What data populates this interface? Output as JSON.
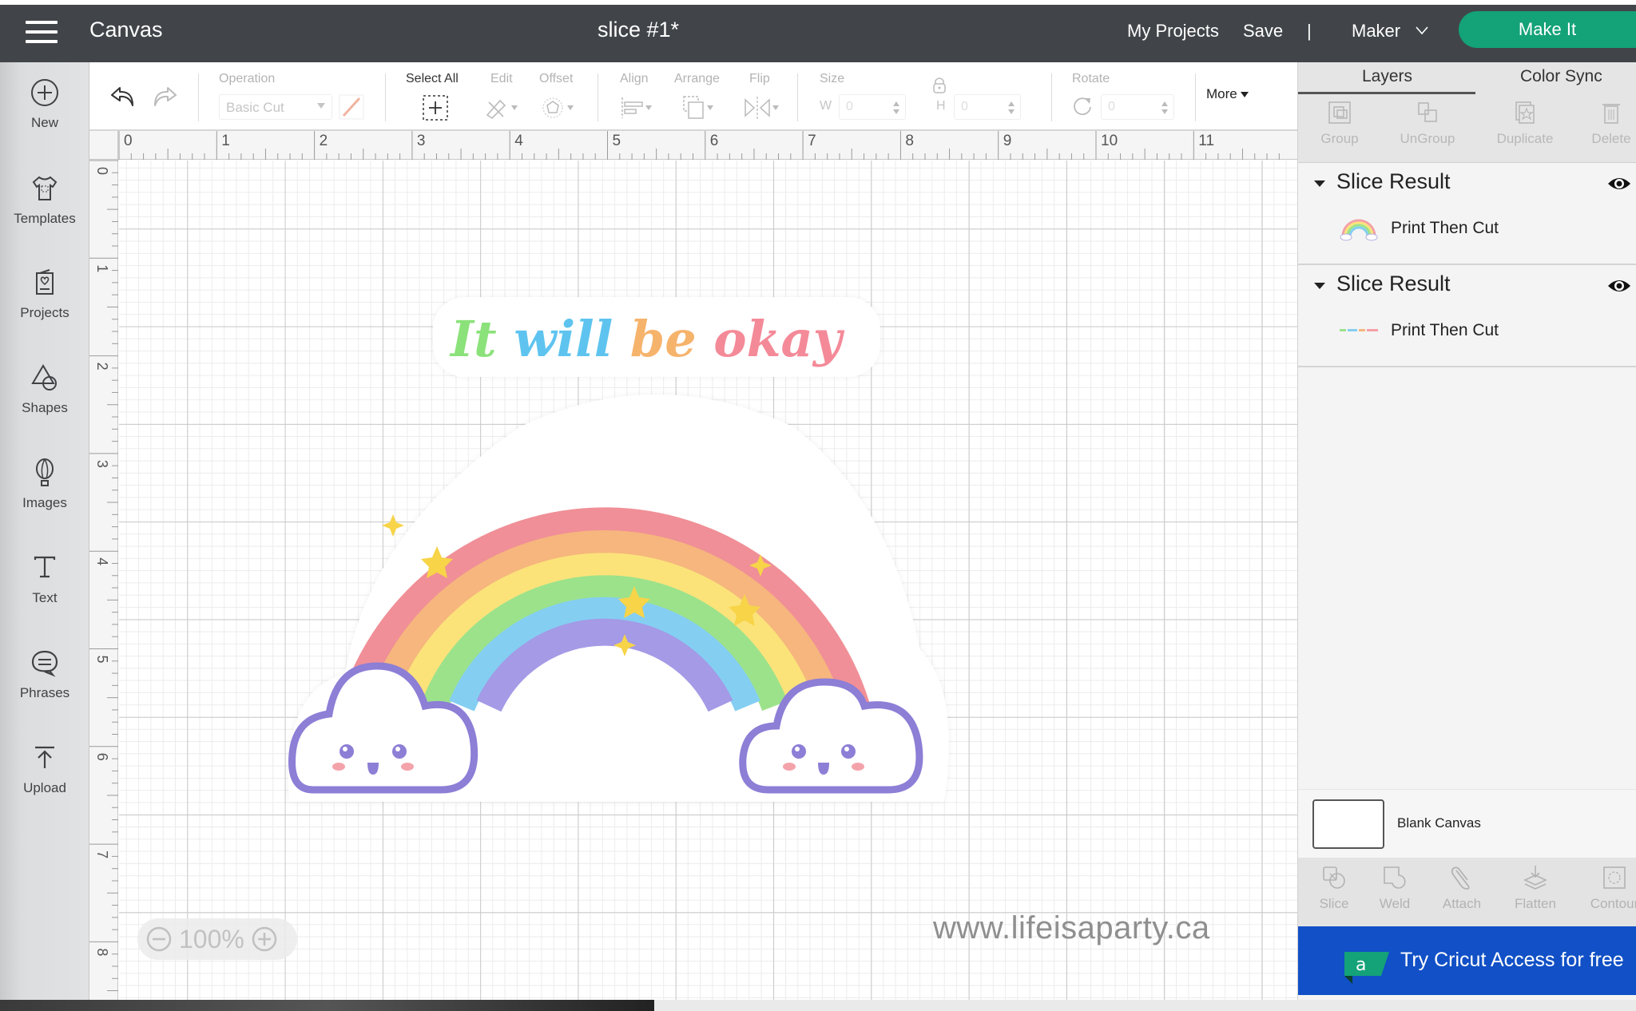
{
  "header": {
    "menu_icon": "hamburger-icon",
    "app_title": "Canvas",
    "document_title": "slice #1*",
    "my_projects": "My Projects",
    "save": "Save",
    "separator": "|",
    "machine": "Maker",
    "make_it": "Make It"
  },
  "sidebar": {
    "items": [
      {
        "label": "New",
        "icon": "plus-circle-icon"
      },
      {
        "label": "Templates",
        "icon": "tshirt-icon"
      },
      {
        "label": "Projects",
        "icon": "project-card-icon"
      },
      {
        "label": "Shapes",
        "icon": "shapes-icon"
      },
      {
        "label": "Images",
        "icon": "balloon-icon"
      },
      {
        "label": "Text",
        "icon": "text-icon"
      },
      {
        "label": "Phrases",
        "icon": "speech-bubble-icon"
      },
      {
        "label": "Upload",
        "icon": "upload-icon"
      }
    ]
  },
  "toolbar": {
    "undo_icon": "undo-icon",
    "redo_icon": "redo-icon",
    "operation_label": "Operation",
    "operation_value": "Basic Cut",
    "select_all_label": "Select All",
    "edit_label": "Edit",
    "offset_label": "Offset",
    "align_label": "Align",
    "arrange_label": "Arrange",
    "flip_label": "Flip",
    "size_label": "Size",
    "width_label": "W",
    "width_value": "0",
    "height_label": "H",
    "height_value": "0",
    "rotate_label": "Rotate",
    "rotate_value": "0",
    "more_label": "More"
  },
  "canvas": {
    "ruler_x": [
      "0",
      "1",
      "2",
      "3",
      "4",
      "5",
      "6",
      "7",
      "8",
      "9",
      "10",
      "11"
    ],
    "ruler_y": [
      "0",
      "1",
      "2",
      "3",
      "4",
      "5",
      "6",
      "7",
      "8"
    ],
    "artwork_text": "It will be okay",
    "zoom_level": "100%",
    "watermark": "www.lifeisaparty.ca"
  },
  "right_panel": {
    "tabs": [
      "Layers",
      "Color Sync"
    ],
    "active_tab": "Layers",
    "layer_tools": [
      "Group",
      "UnGroup",
      "Duplicate",
      "Delete"
    ],
    "groups": [
      {
        "title": "Slice Result",
        "layer": "Print Then Cut",
        "thumb": "rainbow-thumbnail"
      },
      {
        "title": "Slice Result",
        "layer": "Print Then Cut",
        "thumb": "text-thumbnail"
      }
    ],
    "blank_canvas": "Blank Canvas",
    "bottom_tools": [
      "Slice",
      "Weld",
      "Attach",
      "Flatten",
      "Contour"
    ],
    "access_banner": "Try Cricut Access for free"
  },
  "colors": {
    "header_bg": "#414549",
    "make_it_green": "#14a278",
    "access_blue": "#1150c6",
    "access_logo_green": "#14a278"
  }
}
